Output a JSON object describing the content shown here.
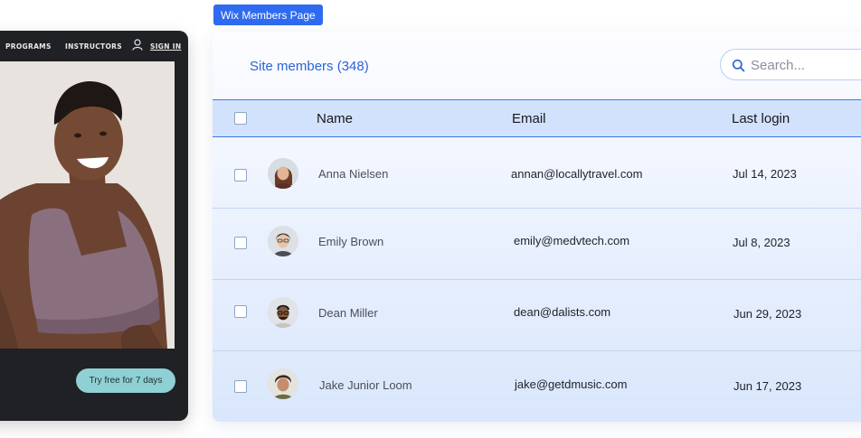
{
  "site": {
    "nav": {
      "programs": "PROGRAMS",
      "instructors": "INSTRUCTORS",
      "sign_in": "SIGN IN"
    },
    "cta_label": "Try free for 7 days",
    "colors": {
      "background": "#1f2124",
      "cta": "#8fd0d4"
    }
  },
  "tag_label": "Wix Members Page",
  "members": {
    "title": "Site members (348)",
    "search_placeholder": "Search...",
    "columns": {
      "name": "Name",
      "email": "Email",
      "last_login": "Last login"
    },
    "rows": [
      {
        "name": "Anna Nielsen",
        "email": "annan@locallytravel.com",
        "last_login": "Jul 14, 2023"
      },
      {
        "name": "Emily Brown",
        "email": "emily@medvtech.com",
        "last_login": "Jul 8, 2023"
      },
      {
        "name": "Dean Miller",
        "email": "dean@dalists.com",
        "last_login": "Jun 29, 2023"
      },
      {
        "name": "Jake Junior Loom",
        "email": "jake@getdmusic.com",
        "last_login": "Jun 17, 2023"
      }
    ],
    "colors": {
      "accent": "#2c63d6",
      "header_bg": "#d3e2fc",
      "tag": "#2f6bf0"
    }
  },
  "icons": {
    "user": "user-icon",
    "search": "search-icon"
  }
}
